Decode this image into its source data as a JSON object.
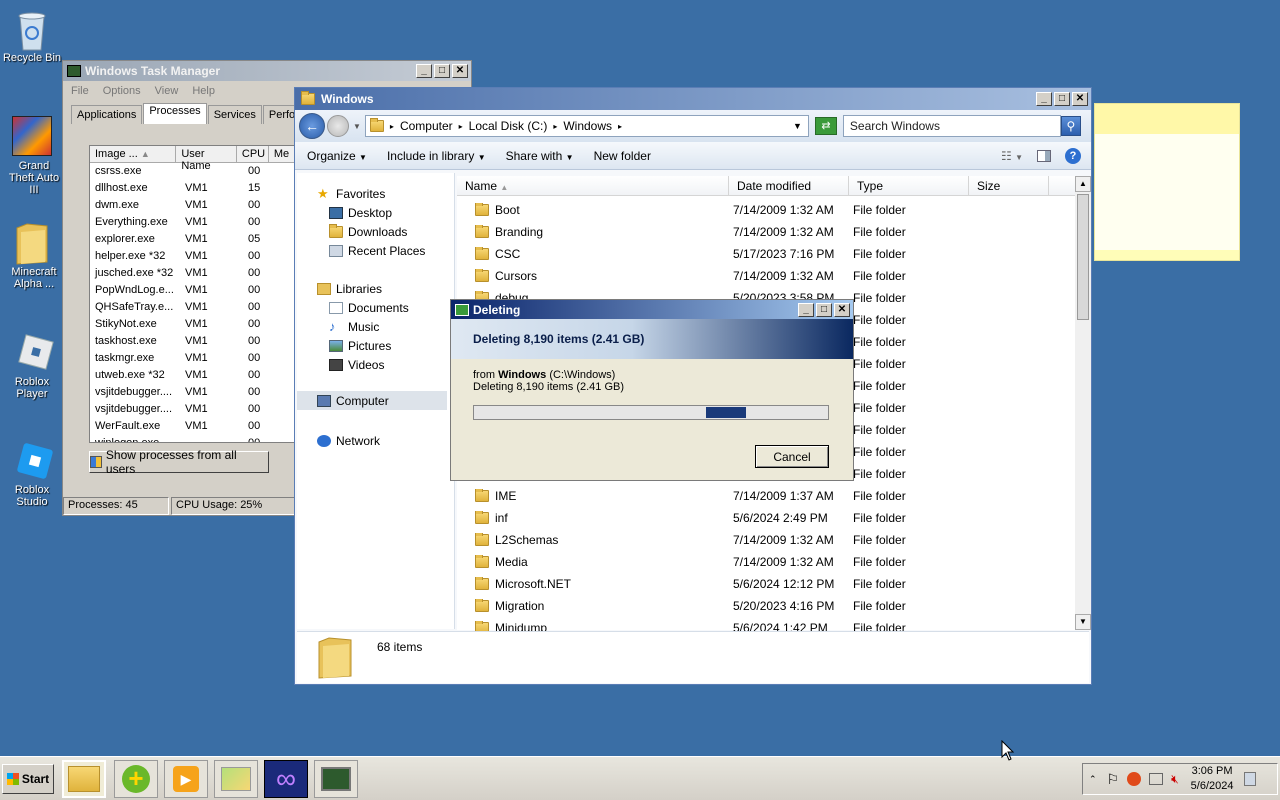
{
  "desktop": {
    "icons": [
      {
        "label": "Recycle Bin",
        "icon": "recycle-bin-icon"
      },
      {
        "label": "Grand Theft Auto III",
        "icon": "gta3-icon"
      },
      {
        "label": "Minecraft Alpha ...",
        "icon": "folder-icon"
      },
      {
        "label": "Roblox Player",
        "icon": "roblox-player-icon"
      },
      {
        "label": "Roblox Studio",
        "icon": "roblox-studio-icon"
      }
    ]
  },
  "task_manager": {
    "title": "Windows Task Manager",
    "menu": [
      "File",
      "Options",
      "View",
      "Help"
    ],
    "tabs": [
      "Applications",
      "Processes",
      "Services",
      "Perform"
    ],
    "active_tab": "Processes",
    "columns": [
      "Image ...",
      "User Name",
      "CPU",
      "Me"
    ],
    "rows": [
      {
        "image": "csrss.exe",
        "user": "",
        "cpu": "00"
      },
      {
        "image": "dllhost.exe",
        "user": "VM1",
        "cpu": "15"
      },
      {
        "image": "dwm.exe",
        "user": "VM1",
        "cpu": "00"
      },
      {
        "image": "Everything.exe",
        "user": "VM1",
        "cpu": "00"
      },
      {
        "image": "explorer.exe",
        "user": "VM1",
        "cpu": "05"
      },
      {
        "image": "helper.exe *32",
        "user": "VM1",
        "cpu": "00"
      },
      {
        "image": "jusched.exe *32",
        "user": "VM1",
        "cpu": "00"
      },
      {
        "image": "PopWndLog.e...",
        "user": "VM1",
        "cpu": "00"
      },
      {
        "image": "QHSafeTray.e...",
        "user": "VM1",
        "cpu": "00"
      },
      {
        "image": "StikyNot.exe",
        "user": "VM1",
        "cpu": "00"
      },
      {
        "image": "taskhost.exe",
        "user": "VM1",
        "cpu": "00"
      },
      {
        "image": "taskmgr.exe",
        "user": "VM1",
        "cpu": "00"
      },
      {
        "image": "utweb.exe *32",
        "user": "VM1",
        "cpu": "00"
      },
      {
        "image": "vsjitdebugger....",
        "user": "VM1",
        "cpu": "00"
      },
      {
        "image": "vsjitdebugger....",
        "user": "VM1",
        "cpu": "00"
      },
      {
        "image": "WerFault.exe",
        "user": "VM1",
        "cpu": "00"
      },
      {
        "image": "winlogon.exe",
        "user": "",
        "cpu": "00"
      }
    ],
    "show_all_button": "Show processes from all users",
    "status_processes": "Processes: 45",
    "status_cpu": "CPU Usage: 25%"
  },
  "explorer": {
    "title": "Windows",
    "breadcrumb": [
      "Computer",
      "Local Disk (C:)",
      "Windows"
    ],
    "search_placeholder": "Search Windows",
    "commands": [
      "Organize",
      "Include in library",
      "Share with",
      "New folder"
    ],
    "nav": {
      "favorites": "Favorites",
      "favorites_items": [
        "Desktop",
        "Downloads",
        "Recent Places"
      ],
      "libraries": "Libraries",
      "libraries_items": [
        "Documents",
        "Music",
        "Pictures",
        "Videos"
      ],
      "computer": "Computer",
      "network": "Network"
    },
    "columns": [
      "Name",
      "Date modified",
      "Type",
      "Size"
    ],
    "files": [
      {
        "name": "Boot",
        "date": "7/14/2009 1:32 AM",
        "type": "File folder"
      },
      {
        "name": "Branding",
        "date": "7/14/2009 1:32 AM",
        "type": "File folder"
      },
      {
        "name": "CSC",
        "date": "5/17/2023 7:16 PM",
        "type": "File folder"
      },
      {
        "name": "Cursors",
        "date": "7/14/2009 1:32 AM",
        "type": "File folder"
      },
      {
        "name": "debug",
        "date": "5/20/2023 3:58 PM",
        "type": "File folder"
      },
      {
        "name": "",
        "date": "",
        "type": "File folder"
      },
      {
        "name": "",
        "date": "",
        "type": "File folder"
      },
      {
        "name": "",
        "date": "",
        "type": "File folder"
      },
      {
        "name": "",
        "date": "",
        "type": "File folder"
      },
      {
        "name": "",
        "date": "",
        "type": "File folder"
      },
      {
        "name": "",
        "date": "",
        "type": "File folder"
      },
      {
        "name": "",
        "date": "",
        "type": "File folder"
      },
      {
        "name": "",
        "date": "",
        "type": "File folder"
      },
      {
        "name": "IME",
        "date": "7/14/2009 1:37 AM",
        "type": "File folder"
      },
      {
        "name": "inf",
        "date": "5/6/2024 2:49 PM",
        "type": "File folder"
      },
      {
        "name": "L2Schemas",
        "date": "7/14/2009 1:32 AM",
        "type": "File folder"
      },
      {
        "name": "Media",
        "date": "7/14/2009 1:32 AM",
        "type": "File folder"
      },
      {
        "name": "Microsoft.NET",
        "date": "5/6/2024 12:12 PM",
        "type": "File folder"
      },
      {
        "name": "Migration",
        "date": "5/20/2023 4:16 PM",
        "type": "File folder"
      },
      {
        "name": "Minidump",
        "date": "5/6/2024 1:42 PM",
        "type": "File folder"
      }
    ],
    "item_count": "68 items"
  },
  "deleting_dialog": {
    "title": "Deleting",
    "header": "Deleting 8,190 items (2.41 GB)",
    "from_label": "from",
    "from_name": "Windows",
    "from_path": "(C:\\Windows)",
    "detail": "Deleting 8,190 items (2.41 GB)",
    "cancel": "Cancel",
    "progress_style": "marquee"
  },
  "taskbar": {
    "start": "Start",
    "time": "3:06 PM",
    "date": "5/6/2024"
  },
  "colors": {
    "desktop": "#3a6ea5",
    "progress": "#1a3a7a",
    "explorer_title": "#4a6ea9"
  }
}
